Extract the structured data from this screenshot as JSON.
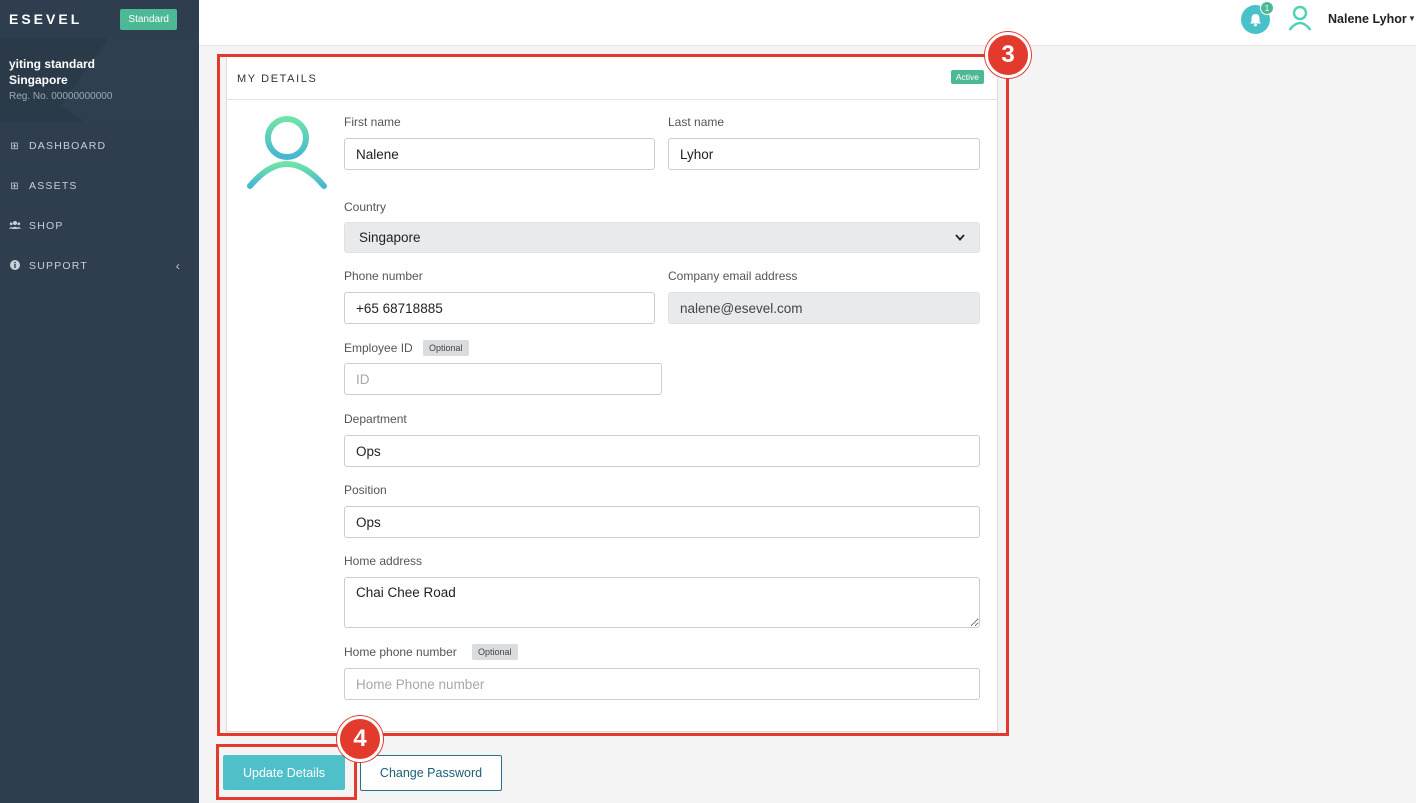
{
  "sidebar": {
    "logo": "ESEVEL",
    "plan_badge": "Standard",
    "company_name": "yiting standard",
    "company_country": "Singapore",
    "reg_no": "Reg. No. 00000000000",
    "items": [
      {
        "label": "DASHBOARD",
        "icon": "grid-icon"
      },
      {
        "label": "ASSETS",
        "icon": "grid-icon"
      },
      {
        "label": "SHOP",
        "icon": "users-icon"
      },
      {
        "label": "SUPPORT",
        "icon": "info-icon"
      }
    ]
  },
  "header": {
    "notification_count": "1",
    "user_name": "Nalene Lyhor",
    "accent": "#49c1c8"
  },
  "card": {
    "title": "MY DETAILS",
    "status": "Active",
    "fields": {
      "first_name": {
        "label": "First name",
        "value": "Nalene"
      },
      "last_name": {
        "label": "Last name",
        "value": "Lyhor"
      },
      "country": {
        "label": "Country",
        "value": "Singapore"
      },
      "phone": {
        "label": "Phone number",
        "value": "+65 68718885"
      },
      "email": {
        "label": "Company email address",
        "value": "nalene@esevel.com"
      },
      "employee_id": {
        "label": "Employee ID",
        "badge": "Optional",
        "placeholder": "ID"
      },
      "department": {
        "label": "Department",
        "value": "Ops"
      },
      "position": {
        "label": "Position",
        "value": "Ops"
      },
      "home_address": {
        "label": "Home address",
        "value": "Chai Chee Road"
      },
      "home_phone": {
        "label": "Home phone number",
        "badge": "Optional",
        "placeholder": "Home Phone number"
      }
    }
  },
  "actions": {
    "update_label": "Update Details",
    "change_password_label": "Change Password"
  },
  "annotations": {
    "step_details": "3",
    "step_update": "4",
    "color": "#e23b2e"
  }
}
